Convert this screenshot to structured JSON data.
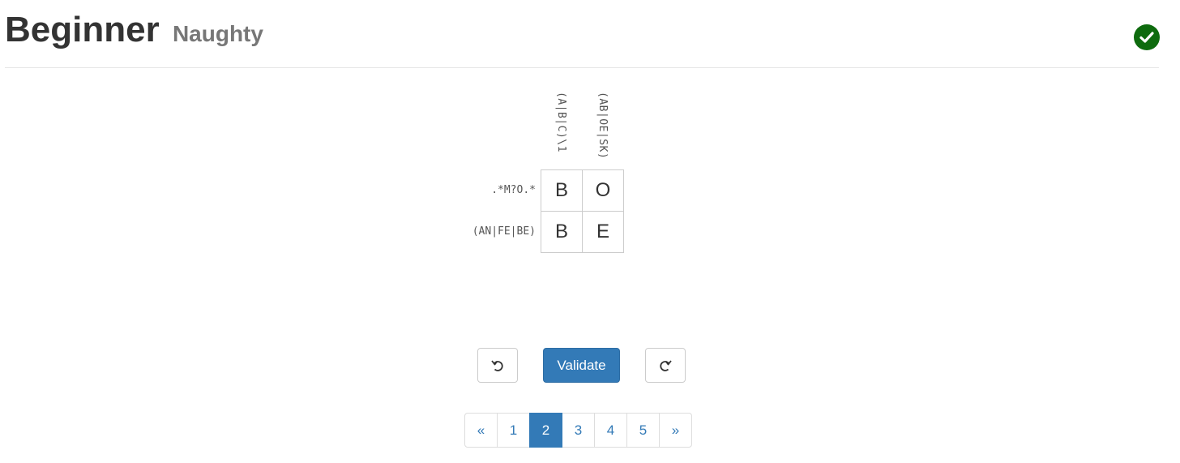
{
  "header": {
    "title": "Beginner",
    "subtitle": "Naughty",
    "status_icon": "check-circle-icon",
    "status_color": "#0e6b0e"
  },
  "puzzle": {
    "column_hints": [
      "(A|B|C)\\1",
      "(AB|OE|SK)"
    ],
    "row_hints": [
      ".*M?O.*",
      "(AN|FE|BE)"
    ],
    "cells": [
      [
        "B",
        "O"
      ],
      [
        "B",
        "E"
      ]
    ]
  },
  "controls": {
    "undo_icon": "undo-icon",
    "validate_label": "Validate",
    "redo_icon": "redo-icon",
    "accent_color": "#337ab7"
  },
  "pagination": {
    "prev_label": "«",
    "pages": [
      "1",
      "2",
      "3",
      "4",
      "5"
    ],
    "current": "2",
    "next_label": "»"
  }
}
